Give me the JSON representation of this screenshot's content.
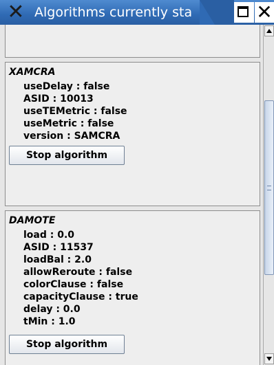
{
  "window": {
    "title": "Algorithms currently starte",
    "icon": "x-window-icon",
    "maximize_icon": "maximize-icon",
    "close_label": "✕"
  },
  "algorithms": [
    {
      "name": "XAMCRA",
      "params": [
        "useDelay : false",
        "ASID : 10013",
        "useTEMetric : false",
        "useMetric : false",
        "version : SAMCRA"
      ],
      "button_label": "Stop algorithm"
    },
    {
      "name": "DAMOTE",
      "params": [
        "load : 0.0",
        "ASID : 11537",
        "loadBal : 2.0",
        "allowReroute : false",
        "colorClause : false",
        "capacityClause : true",
        "delay : 0.0",
        "tMin : 1.0"
      ],
      "button_label": "Stop algorithm"
    }
  ],
  "scrollbar": {
    "position_fraction": 0.45,
    "visible_fraction": 0.55
  }
}
